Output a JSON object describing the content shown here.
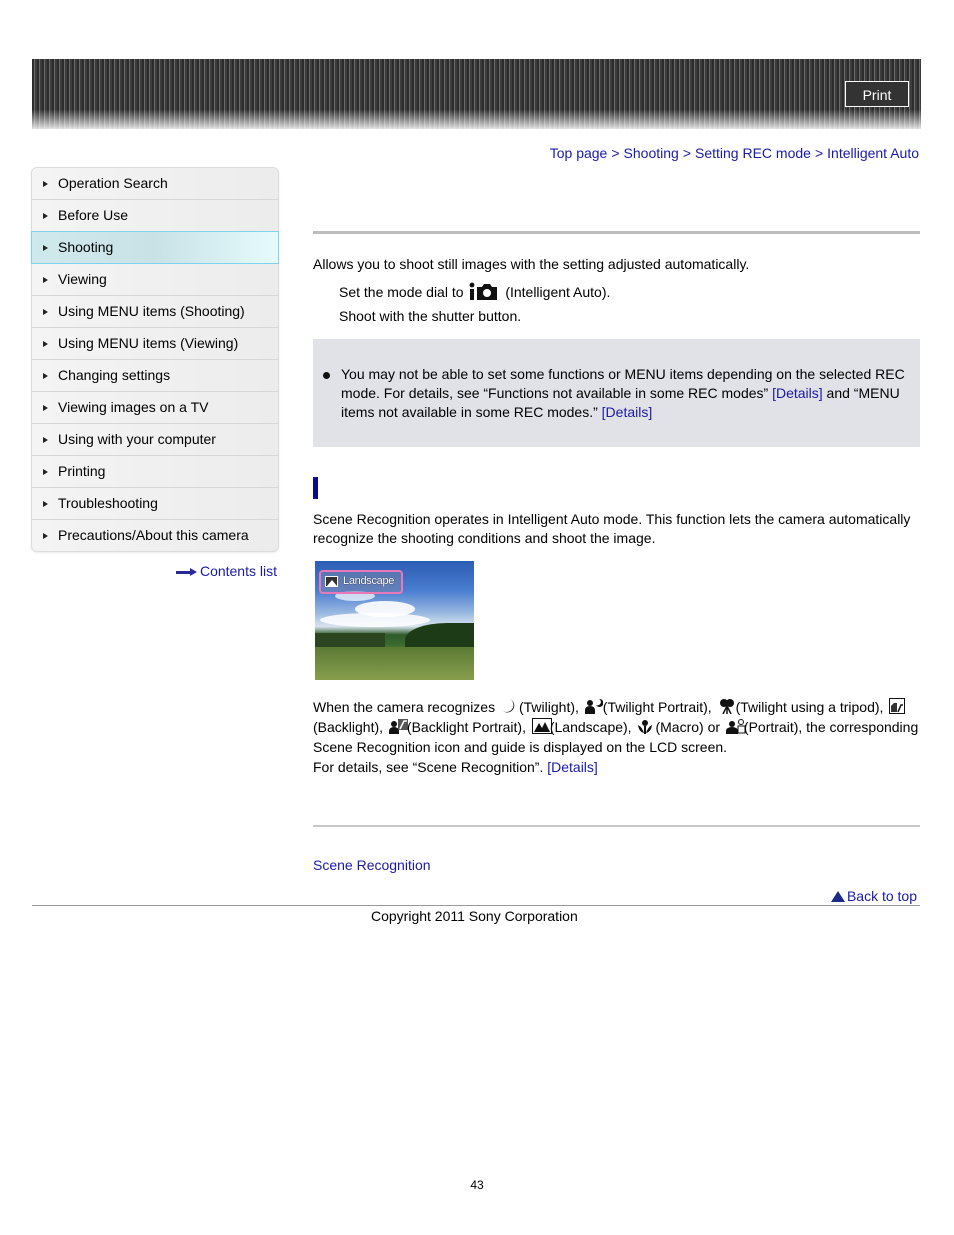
{
  "header": {
    "print_label": "Print"
  },
  "breadcrumb": [
    {
      "label": "Top page"
    },
    {
      "label": "Shooting"
    },
    {
      "label": "Setting REC mode"
    },
    {
      "label": "Intelligent Auto"
    }
  ],
  "breadcrumb_separator": ">",
  "sidebar": {
    "items": [
      {
        "label": "Operation Search",
        "active": false
      },
      {
        "label": "Before Use",
        "active": false
      },
      {
        "label": "Shooting",
        "active": true
      },
      {
        "label": "Viewing",
        "active": false
      },
      {
        "label": "Using MENU items (Shooting)",
        "active": false
      },
      {
        "label": "Using MENU items (Viewing)",
        "active": false
      },
      {
        "label": "Changing settings",
        "active": false
      },
      {
        "label": "Viewing images on a TV",
        "active": false
      },
      {
        "label": "Using with your computer",
        "active": false
      },
      {
        "label": "Printing",
        "active": false
      },
      {
        "label": "Troubleshooting",
        "active": false
      },
      {
        "label": "Precautions/About this camera",
        "active": false
      }
    ],
    "contents_list_label": "Contents list"
  },
  "main": {
    "intro": "Allows you to shoot still images with the setting adjusted automatically.",
    "steps": [
      {
        "before": "Set the mode dial to",
        "icon": "intelligent-auto-icon",
        "after": "(Intelligent Auto)."
      },
      {
        "text": "Shoot with the shutter button."
      }
    ],
    "note": {
      "part1": "You may not be able to set some functions or MENU items depending on the selected REC mode. For details, see “Functions not available in some REC modes” ",
      "link1": "[Details]",
      "part2": " and “MENU items not available in some REC modes.” ",
      "link2": "[Details]"
    },
    "scene_text": "Scene Recognition operates in Intelligent Auto mode. This function lets the camera automatically recognize the shooting conditions and shoot the image.",
    "photo_label": "Landscape",
    "recognize": {
      "lead": "When the camera recognizes",
      "modes": [
        {
          "icon": "twilight-icon",
          "label": "(Twilight),",
          "sep": " "
        },
        {
          "icon": "twilight-portrait-icon",
          "label": "(Twilight Portrait),",
          "sep": " "
        },
        {
          "icon": "twilight-tripod-icon",
          "label": "(Twilight using a tripod),",
          "sep": " "
        },
        {
          "icon": "backlight-icon",
          "label": "(Backlight),",
          "sep": " "
        },
        {
          "icon": "backlight-portrait-icon",
          "label": "(Backlight Portrait),",
          "sep": " "
        },
        {
          "icon": "landscape-icon",
          "label": "(Landscape),",
          "sep": " "
        },
        {
          "icon": "macro-icon",
          "label": "(Macro) or",
          "sep": " "
        },
        {
          "icon": "portrait-icon",
          "label": "(Portrait), the",
          "sep": " "
        }
      ],
      "tail": "corresponding Scene Recognition icon and guide is displayed on the LCD screen.",
      "details_prefix": "For details, see “Scene Recognition”.",
      "details_link": "[Details]"
    },
    "related_link": "Scene Recognition",
    "back_to_top": "Back to top"
  },
  "footer": {
    "copyright": "Copyright 2011 Sony Corporation",
    "page_number": "43"
  },
  "colors": {
    "link": "#1a1aa6",
    "section_bar": "#0a0a8c",
    "note_bg": "#e0e2e7",
    "active_item_border": "#7fd3ec"
  }
}
